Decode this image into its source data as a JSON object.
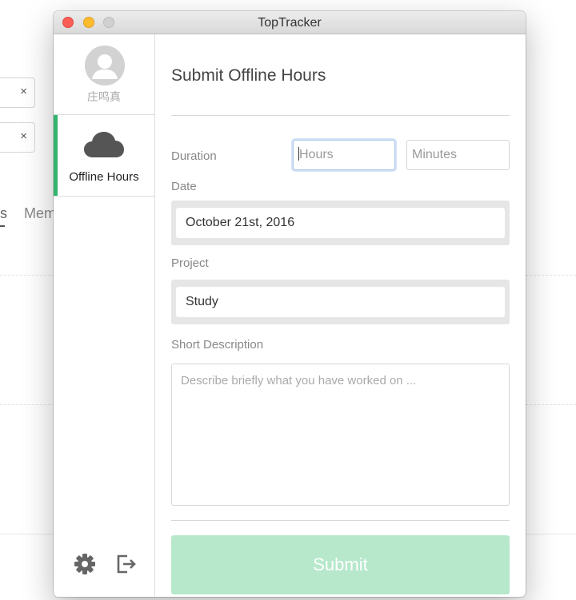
{
  "window": {
    "title": "TopTracker"
  },
  "background": {
    "tab_a": "s",
    "tab_b": "Mem",
    "clear_icon": "×"
  },
  "sidebar": {
    "username": "庄鸣真",
    "nav_item_label": "Offline Hours",
    "icons": [
      "avatar-icon",
      "cloud-icon",
      "gear-icon",
      "logout-icon"
    ]
  },
  "form": {
    "title": "Submit Offline Hours",
    "duration_label": "Duration",
    "hours_placeholder": "Hours",
    "minutes_placeholder": "Minutes",
    "date_label": "Date",
    "date_value": "October 21st, 2016",
    "project_label": "Project",
    "project_value": "Study",
    "description_label": "Short Description",
    "description_placeholder": "Describe briefly what you have worked on ...",
    "submit_label": "Submit"
  },
  "colors": {
    "accent": "#31b46e",
    "submit_disabled": "#b7e8cc"
  }
}
